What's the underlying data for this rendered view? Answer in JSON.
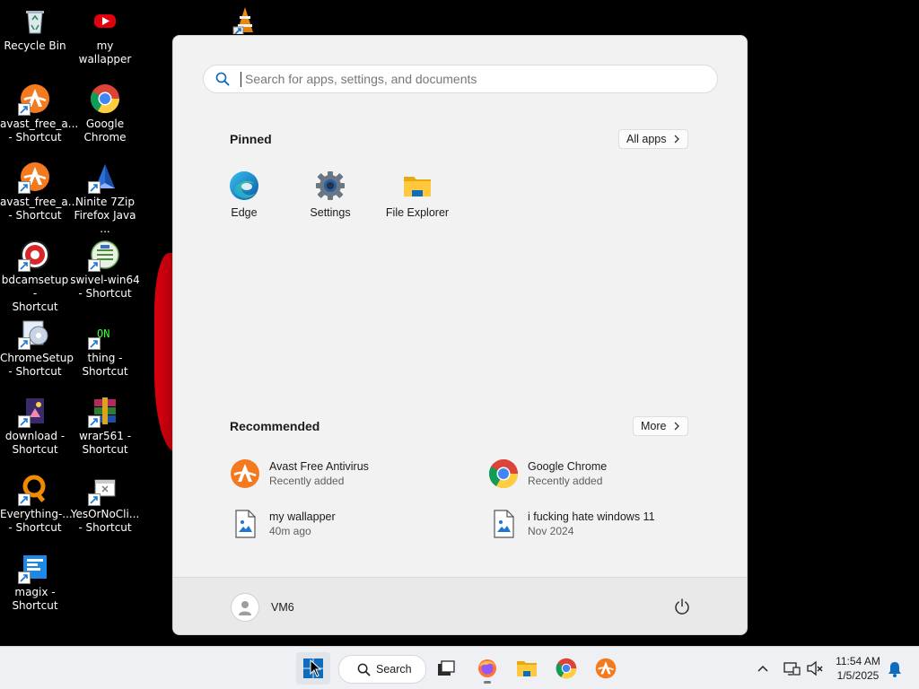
{
  "desktop": {
    "icons": [
      {
        "label": "Recycle Bin",
        "icon": "recycle-bin-icon"
      },
      {
        "label": "my wallapper",
        "icon": "youtube-icon"
      },
      {
        "label": "avast_free_a...\n- Shortcut",
        "icon": "avast-icon"
      },
      {
        "label": "Google\nChrome",
        "icon": "chrome-icon"
      },
      {
        "label": "avast_free_a...\n- Shortcut",
        "icon": "avast-icon"
      },
      {
        "label": "Ninite 7Zip\nFirefox Java ...",
        "icon": "ninite-icon"
      },
      {
        "label": "bdcamsetup -\nShortcut",
        "icon": "bandicam-icon"
      },
      {
        "label": "swivel-win64\n- Shortcut",
        "icon": "swivel-icon"
      },
      {
        "label": "ChromeSetup\n- Shortcut",
        "icon": "setup-disc-icon"
      },
      {
        "label": "thing -\nShortcut",
        "icon": "terminal-on-icon"
      },
      {
        "label": "download -\nShortcut",
        "icon": "image-file-icon"
      },
      {
        "label": "wrar561 -\nShortcut",
        "icon": "winrar-icon"
      },
      {
        "label": "Everything-...\n- Shortcut",
        "icon": "everything-icon"
      },
      {
        "label": "YesOrNoCli...\n- Shortcut",
        "icon": "app-window-icon"
      },
      {
        "label": "magix -\nShortcut",
        "icon": "magix-icon"
      }
    ]
  },
  "start_menu": {
    "search_placeholder": "Search for apps, settings, and documents",
    "pinned": {
      "title": "Pinned",
      "all_apps_label": "All apps",
      "apps": [
        {
          "label": "Edge",
          "icon": "edge-icon"
        },
        {
          "label": "Settings",
          "icon": "settings-gear-icon"
        },
        {
          "label": "File Explorer",
          "icon": "folder-icon"
        }
      ]
    },
    "recommended": {
      "title": "Recommended",
      "more_label": "More",
      "items": [
        {
          "name": "Avast Free Antivirus",
          "sub": "Recently added",
          "icon": "avast-icon"
        },
        {
          "name": "Google Chrome",
          "sub": "Recently added",
          "icon": "chrome-icon"
        },
        {
          "name": "my wallapper",
          "sub": "40m ago",
          "icon": "image-file-icon"
        },
        {
          "name": "i fucking hate windows 11",
          "sub": "Nov 2024",
          "icon": "image-file-icon"
        }
      ]
    },
    "user": {
      "name": "VM6"
    }
  },
  "taskbar": {
    "search_label": "Search",
    "apps": [
      "start-icon",
      "task-view-icon",
      "firefox-icon",
      "file-explorer-icon",
      "chrome-icon",
      "avast-icon"
    ],
    "clock": {
      "time": "11:54 AM",
      "date": "1/5/2025"
    }
  },
  "colors": {
    "accent": "#0067c0",
    "menu_bg": "#f2f2f2",
    "taskbar_bg": "#eef0f3",
    "wallpaper_red": "#e1000f"
  }
}
